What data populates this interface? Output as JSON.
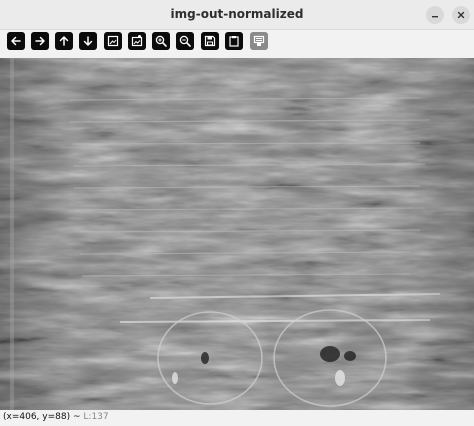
{
  "window": {
    "title": "img-out-normalized"
  },
  "window_controls": [
    {
      "name": "minimize-icon"
    },
    {
      "name": "close-icon"
    }
  ],
  "toolbar": {
    "buttons": [
      {
        "name": "pan-left",
        "icon": "arrow-left-icon"
      },
      {
        "name": "pan-right",
        "icon": "arrow-right-icon"
      },
      {
        "name": "pan-up",
        "icon": "arrow-up-icon"
      },
      {
        "name": "pan-down",
        "icon": "arrow-down-icon"
      },
      {
        "name": "zoom-fit",
        "icon": "zoom-fit-icon"
      },
      {
        "name": "zoom-original",
        "icon": "zoom-original-icon"
      },
      {
        "name": "zoom-in",
        "icon": "zoom-in-icon"
      },
      {
        "name": "zoom-out",
        "icon": "zoom-out-icon"
      },
      {
        "name": "save-image",
        "icon": "save-icon"
      },
      {
        "name": "copy-clipboard",
        "icon": "clipboard-icon"
      },
      {
        "name": "properties",
        "icon": "properties-icon"
      }
    ]
  },
  "statusbar": {
    "coords": "(x=406, y=88)",
    "separator": "~",
    "value": "L:137"
  },
  "colors": {
    "titlebar_bg": "#ebebeb",
    "toolbar_button_bg": "#0b0b0b",
    "toolbar_button_disabled": "#8a8a8a",
    "status_value": "#888888"
  }
}
